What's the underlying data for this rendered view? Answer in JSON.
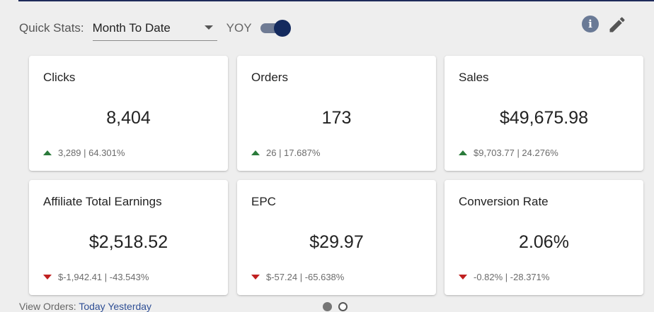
{
  "toolbar": {
    "quick_stats_label": "Quick Stats:",
    "period_value": "Month To Date",
    "yoy_label": "YOY",
    "yoy_enabled": true
  },
  "icons": {
    "info": "i"
  },
  "colors": {
    "accent": "#142a5e",
    "up": "#2a7a3a",
    "down": "#c02020"
  },
  "cards": [
    {
      "title": "Clicks",
      "value": "8,404",
      "delta": "3,289 | 64.301%",
      "trend": "up"
    },
    {
      "title": "Orders",
      "value": "173",
      "delta": "26 | 17.687%",
      "trend": "up"
    },
    {
      "title": "Sales",
      "value": "$49,675.98",
      "delta": "$9,703.77 | 24.276%",
      "trend": "up"
    },
    {
      "title": "Affiliate Total Earnings",
      "value": "$2,518.52",
      "delta": "$-1,942.41 | -43.543%",
      "trend": "down"
    },
    {
      "title": "EPC",
      "value": "$29.97",
      "delta": "$-57.24 | -65.638%",
      "trend": "down"
    },
    {
      "title": "Conversion Rate",
      "value": "2.06%",
      "delta": "-0.82% | -28.371%",
      "trend": "down"
    }
  ],
  "footer": {
    "view_orders_label": "View Orders:",
    "today_link": "Today",
    "yesterday_link": "Yesterday"
  },
  "pagination": {
    "current_page": 1,
    "total_pages": 2
  }
}
